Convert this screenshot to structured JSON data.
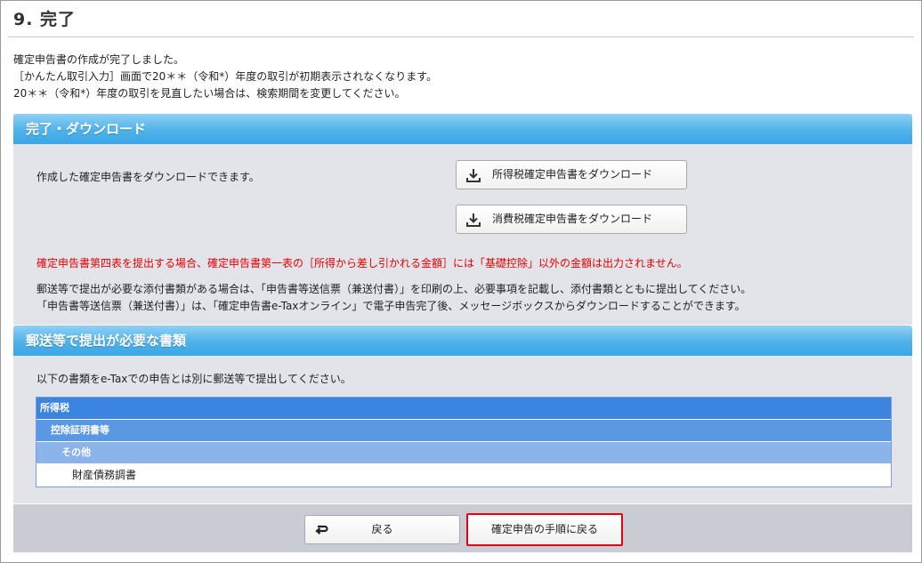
{
  "page": {
    "title": "9.  完了"
  },
  "intro": {
    "lines": [
      "確定申告書の作成が完了しました。",
      "［かんたん取引入力］画面で20＊＊（令和*）年度の取引が初期表示されなくなります。",
      "20＊＊（令和*）年度の取引を見直したい場合は、検索期間を変更してください。"
    ]
  },
  "download_panel": {
    "header": "完了・ダウンロード",
    "description": "作成した確定申告書をダウンロードできます。",
    "income_tax_button": "所得税確定申告書をダウンロード",
    "consumption_tax_button": "消費税確定申告書をダウンロード",
    "warning": "確定申告書第四表を提出する場合、確定申告書第一表の［所得から差し引かれる金額］には「基礎控除」以外の金額は出力されません。",
    "note_lines": [
      "郵送等で提出が必要な添付書類がある場合は、「申告書等送信票（兼送付書）」を印刷の上、必要事項を記載し、添付書類とともに提出してください。",
      "「申告書等送信票（兼送付書）」は、「確定申告書e-Taxオンライン」で電子申告完了後、メッセージボックスからダウンロードすることができます。"
    ]
  },
  "mail_panel": {
    "header": "郵送等で提出が必要な書類",
    "description": "以下の書類をe-Taxでの申告とは別に郵送等で提出してください。",
    "rows": {
      "level1": "所得税",
      "level2": "控除証明書等",
      "level3": "その他",
      "level4": "財産債務調書"
    }
  },
  "footer": {
    "back_button": "戻る",
    "return_button": "確定申告の手順に戻る"
  },
  "icons": {
    "download": "download-icon",
    "back": "return-arrow-icon"
  },
  "colors": {
    "panel_header": "#4fb2ea",
    "warning_text": "#e60000",
    "highlight_border": "#e60012",
    "table_level1": "#3b84df"
  }
}
